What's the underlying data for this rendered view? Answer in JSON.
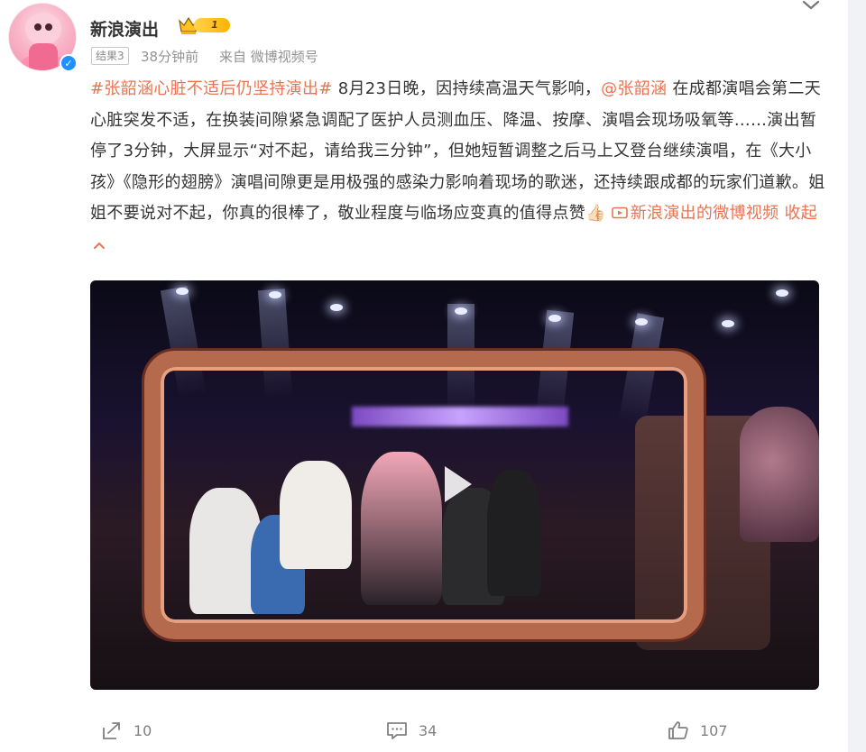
{
  "post": {
    "author": "新浪演出",
    "vip_level": "1",
    "result_tag": "结果3",
    "time_ago": "38分钟前",
    "source": "来自 微博视频号",
    "content": {
      "hashtag": "#张韶涵心脏不适后仍坚持演出#",
      "text1": " 8月23日晚，因持续高温天气影响，",
      "mention": "@张韶涵",
      "text2": " 在成都演唱会第二天心脏突发不适，在换装间隙紧急调配了医护人员测血压、降温、按摩、演唱会现场吸氧等……演出暂停了3分钟，大屏显示“对不起，请给我三分钟”，但她短暂调整之后马上又登台继续演唱，在《大小孩》《隐形的翅膀》演唱间隙更是用极强的感染力影响着现场的歌迷，还持续跟成都的玩家们道歉。姐姐不要说对不起，你真的很棒了，敬业程度与临场应变真的值得点赞👍🏻 ",
      "video_link": "新浪演出的微博视频",
      "collapse": "收起"
    },
    "actions": {
      "repost_count": "10",
      "comment_count": "34",
      "like_count": "107"
    },
    "colors": {
      "accent": "#eb7350",
      "verified": "#1e90ff",
      "vip": "#ffb300",
      "meta": "#939393"
    },
    "icons": {
      "repost": "share-arrow-icon",
      "comment": "comment-bubble-icon",
      "like": "thumbs-up-icon",
      "video": "video-play-icon",
      "menu": "chevron-down-icon"
    }
  }
}
